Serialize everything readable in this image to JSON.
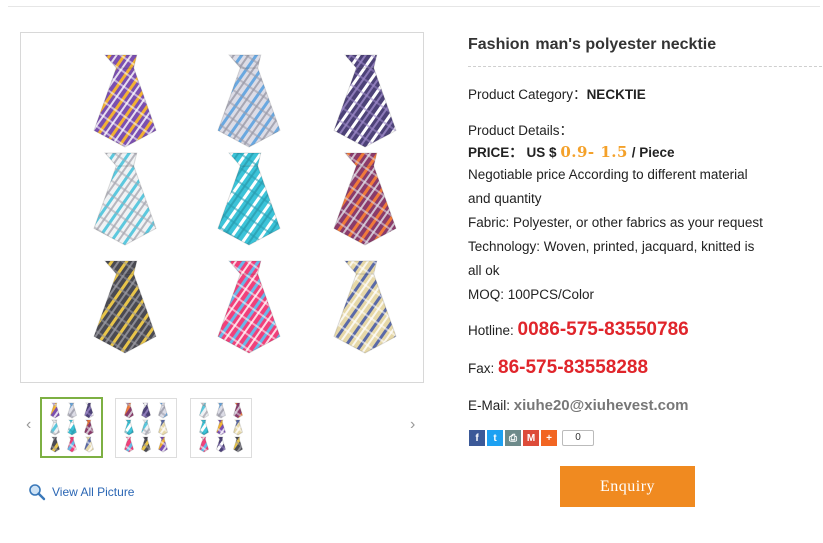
{
  "product": {
    "title_part1": "Fashion",
    "title_part2": "man's polyester necktie",
    "category_label": "Product Category：",
    "category_value": "NECKTIE",
    "details_label": "Product Details：",
    "price_label": "PRICE：",
    "price_currency": "US $",
    "price_value": "0.9- 1.5",
    "price_unit": "/ Piece",
    "desc_lines": [
      "Negotiable price According to different material",
      "and quantity",
      "Fabric: Polyester, or other fabrics as your request",
      "Technology: Woven, printed, jacquard, knitted is",
      "all ok",
      "MOQ: 100PCS/Color"
    ],
    "hotline_label": "Hotline:",
    "hotline_value": "0086-575-83550786",
    "fax_label": "Fax:",
    "fax_value": "86-575-83558288",
    "email_label": "E-Mail:",
    "email_value": "xiuhe20@xiuhevest.com"
  },
  "share": {
    "icons": [
      "facebook-icon",
      "twitter-icon",
      "print-icon",
      "gmail-icon",
      "plus-icon"
    ],
    "count": "0",
    "colors": {
      "facebook": "#3b5998",
      "twitter": "#1da1f2",
      "print": "#6d8a8a",
      "gmail": "#dd4b39",
      "plus": "#f26522"
    }
  },
  "gallery": {
    "view_all_label": "View All Picture",
    "prev_glyph": "‹",
    "next_glyph": "›"
  },
  "enquiry_label": "Enquiry",
  "colors": {
    "accent_orange": "#f08a20",
    "phone_red": "#e0252b",
    "price_orange": "#f4a12a",
    "link_blue": "#2a66b4"
  }
}
